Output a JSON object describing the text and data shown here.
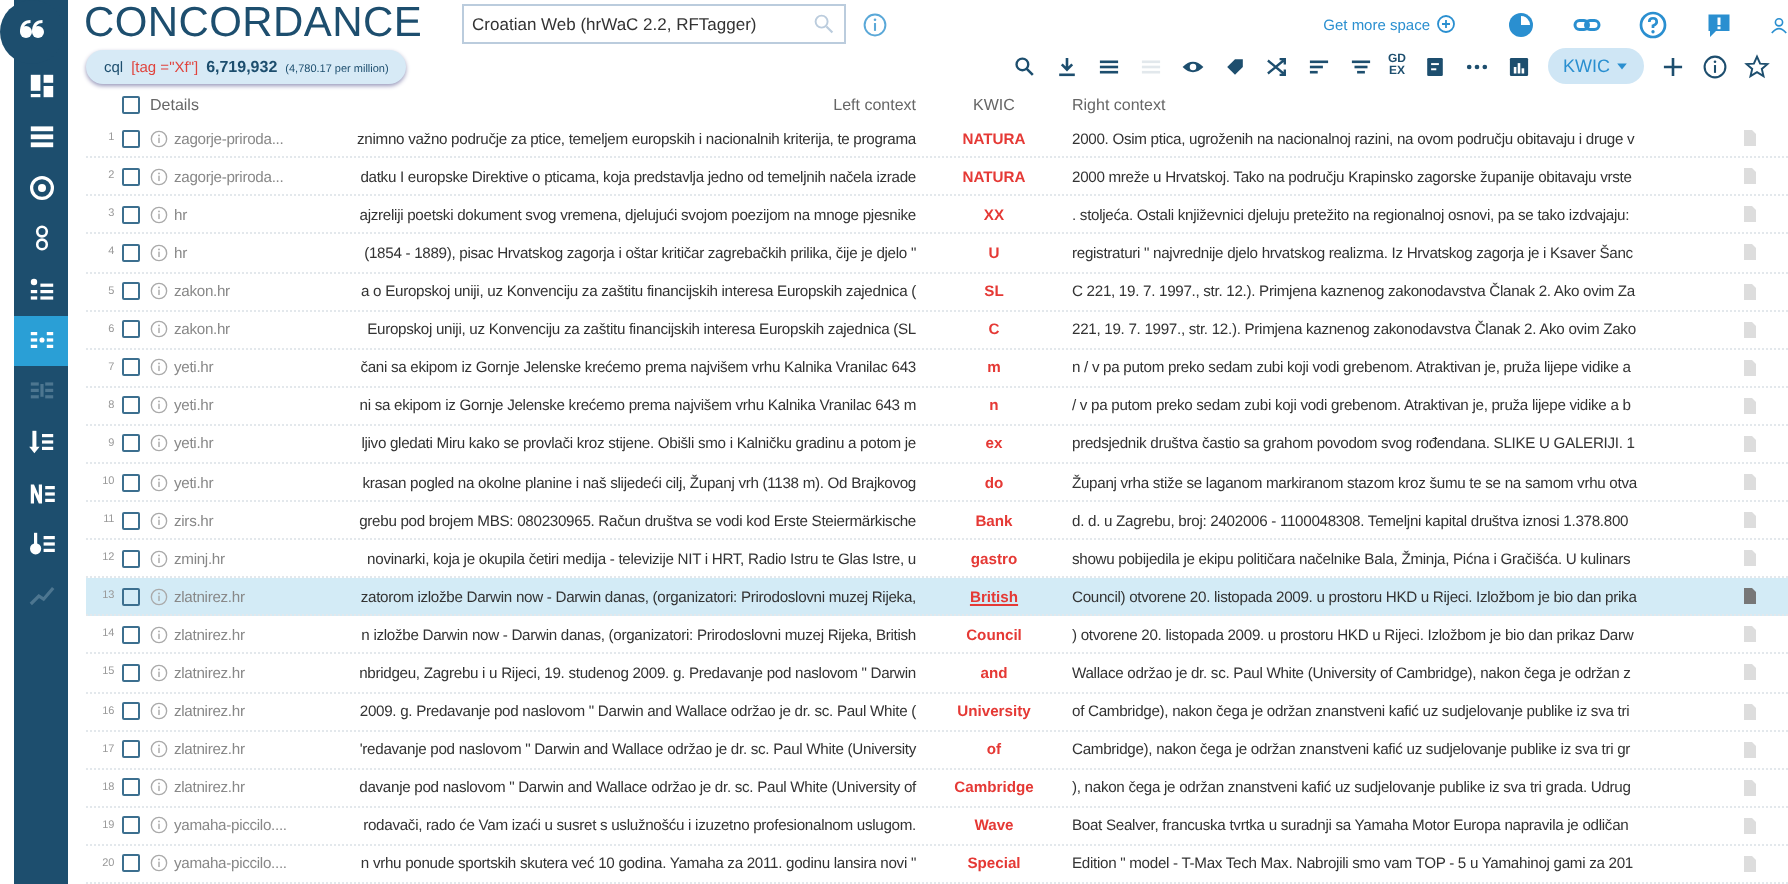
{
  "app": {
    "title": "CONCORDANCE"
  },
  "corpus_field": {
    "value": "Croatian Web (hrWaC 2.2, RFTagger)"
  },
  "get_more_space": "Get more space",
  "query": {
    "type": "cql",
    "expression": "[tag =\"Xf\"]",
    "count": "6,719,932",
    "per_million": "(4,780.17 per million)"
  },
  "sidebar": [
    {
      "kind": "dashboard",
      "selected": false,
      "disabled": false
    },
    {
      "kind": "list",
      "selected": false,
      "disabled": false
    },
    {
      "kind": "target",
      "selected": false,
      "disabled": false
    },
    {
      "kind": "chain",
      "selected": false,
      "disabled": false
    },
    {
      "kind": "bullets",
      "selected": false,
      "disabled": false
    },
    {
      "kind": "concordance",
      "selected": true,
      "disabled": false
    },
    {
      "kind": "parallel",
      "selected": false,
      "disabled": true
    },
    {
      "kind": "sort",
      "selected": false,
      "disabled": false
    },
    {
      "kind": "entities",
      "selected": false,
      "disabled": false
    },
    {
      "kind": "frequency",
      "selected": false,
      "disabled": false
    },
    {
      "kind": "trend",
      "selected": false,
      "disabled": true
    }
  ],
  "toolbar": {
    "items": [
      {
        "kind": "search",
        "disabled": false
      },
      {
        "kind": "download",
        "disabled": false
      },
      {
        "kind": "lines",
        "disabled": false
      },
      {
        "kind": "lines",
        "disabled": true
      },
      {
        "kind": "eye",
        "disabled": false
      },
      {
        "kind": "tag",
        "disabled": false
      },
      {
        "kind": "shuffle",
        "disabled": false
      },
      {
        "kind": "sort-left",
        "disabled": false
      },
      {
        "kind": "filter",
        "disabled": false
      },
      {
        "kind": "gdex",
        "label": "GD EX",
        "disabled": false
      },
      {
        "kind": "document",
        "disabled": false
      },
      {
        "kind": "dots",
        "disabled": false
      },
      {
        "kind": "chart",
        "disabled": false
      }
    ],
    "view_mode": "KWIC"
  },
  "table": {
    "all_checked": false,
    "columns": [
      "Details",
      "Left context",
      "KWIC",
      "Right context"
    ],
    "rows": [
      {
        "number": "1",
        "details": "zagorje-priroda...",
        "left": "znimno važno područje za ptice, temeljem europskih i nacionalnih kriterija, te programa",
        "kwic": "NATURA",
        "right": "2000. Osim ptica, ugroženih na nacionalnoj razini, na ovom području obitavaju i druge v",
        "checked": false,
        "selected": false
      },
      {
        "number": "2",
        "details": "zagorje-priroda...",
        "left": "datku I europske Direktive o pticama, koja predstavlja jedno od temeljnih načela izrade",
        "kwic": "NATURA",
        "right": "2000 mreže u Hrvatskoj. Tako na području Krapinsko zagorske županije obitavaju vrste",
        "checked": false,
        "selected": false
      },
      {
        "number": "3",
        "details": "hr",
        "left": "ajzreliji poetski dokument svog vremena, djelujući svojom poezijom na mnoge pjesnike",
        "kwic": "XX",
        "right": ". stoljeća. Ostali književnici djeluju pretežito na regionalnoj osnovi, pa se tako izdvajaju:",
        "checked": false,
        "selected": false
      },
      {
        "number": "4",
        "details": "hr",
        "left": "(1854 - 1889), pisac Hrvatskog zagorja i oštar kritičar zagrebačkih prilika, čije je djelo \"",
        "kwic": "U",
        "right": "registraturi \" najvrednije djelo hrvatskog realizma. Iz Hrvatskog zagorja je i Ksaver Šanc",
        "checked": false,
        "selected": false
      },
      {
        "number": "5",
        "details": "zakon.hr",
        "left": "a o Europskoj uniji, uz Konvenciju za zaštitu financijskih interesa Europskih zajednica (",
        "kwic": "SL",
        "right": "C 221, 19. 7. 1997., str. 12.). Primjena kaznenog zakonodavstva Članak 2. Ako ovim Za",
        "checked": false,
        "selected": false
      },
      {
        "number": "6",
        "details": "zakon.hr",
        "left": "Europskoj uniji, uz Konvenciju za zaštitu financijskih interesa Europskih zajednica (SL",
        "kwic": "C",
        "right": "221, 19. 7. 1997., str. 12.). Primjena kaznenog zakonodavstva Članak 2. Ako ovim Zako",
        "checked": false,
        "selected": false
      },
      {
        "number": "7",
        "details": "yeti.hr",
        "left": "čani sa ekipom iz Gornje Jelenske krećemo prema najvišem vrhu Kalnika Vranilac 643",
        "kwic": "m",
        "right": "n / v pa putom preko sedam zubi koji vodi grebenom. Atraktivan je, pruža lijepe vidike a",
        "checked": false,
        "selected": false
      },
      {
        "number": "8",
        "details": "yeti.hr",
        "left": "ni sa ekipom iz Gornje Jelenske krećemo prema najvišem vrhu Kalnika Vranilac 643 m",
        "kwic": "n",
        "right": "/ v pa putom preko sedam zubi koji vodi grebenom. Atraktivan je, pruža lijepe vidike a b",
        "checked": false,
        "selected": false
      },
      {
        "number": "9",
        "details": "yeti.hr",
        "left": "ljivo gledati Miru kako se provlači kroz stijene. Obišli smo i Kalničku gradinu a potom je",
        "kwic": "ex",
        "right": "predsjednik društva častio sa grahom povodom svog rođendana. SLIKE U GALERIJI. 1",
        "checked": false,
        "selected": false
      },
      {
        "number": "10",
        "details": "yeti.hr",
        "left": "krasan pogled na okolne planine i naš slijedeći cilj, Županj vrh (1138 m). Od Brajkovog",
        "kwic": "do",
        "right": "Županj vrha stiže se laganom markiranom stazom kroz šumu te se na samom vrhu otva",
        "checked": false,
        "selected": false
      },
      {
        "number": "11",
        "details": "zirs.hr",
        "left": "grebu pod brojem MBS: 080230965. Račun društva se vodi kod Erste Steiermärkische",
        "kwic": "Bank",
        "right": "d. d. u Zagrebu, broj: 2402006 - 1100048308. Temeljni kapital društva iznosi 1.378.800",
        "checked": false,
        "selected": false
      },
      {
        "number": "12",
        "details": "zminj.hr",
        "left": "novinarki, koja je okupila četiri medija - televizije NIT i HRT, Radio Istru te Glas Istre, u",
        "kwic": "gastro",
        "right": "showu pobijedila je ekipu političara načelnike Bala, Žminja, Pićna i Gračišća. U kulinars",
        "checked": false,
        "selected": false
      },
      {
        "number": "13",
        "details": "zlatnirez.hr",
        "left": "zatorom izložbe Darwin now - Darwin danas, (organizatori: Prirodoslovni muzej Rijeka,",
        "kwic": "British",
        "right": "Council) otvorene 20. listopada 2009. u prostoru HKD u Rijeci. Izložbom je bio dan prika",
        "checked": false,
        "selected": true
      },
      {
        "number": "14",
        "details": "zlatnirez.hr",
        "left": "n izložbe Darwin now - Darwin danas, (organizatori: Prirodoslovni muzej Rijeka, British",
        "kwic": "Council",
        "right": ") otvorene 20. listopada 2009. u prostoru HKD u Rijeci. Izložbom je bio dan prikaz Darw",
        "checked": false,
        "selected": false
      },
      {
        "number": "15",
        "details": "zlatnirez.hr",
        "left": "nbridgeu, Zagrebu i u Rijeci, 19. studenog 2009. g. Predavanje pod naslovom \" Darwin",
        "kwic": "and",
        "right": "Wallace održao je dr. sc. Paul White (University of Cambridge), nakon čega je održan z",
        "checked": false,
        "selected": false
      },
      {
        "number": "16",
        "details": "zlatnirez.hr",
        "left": "2009. g. Predavanje pod naslovom \" Darwin and Wallace održao je dr. sc. Paul White (",
        "kwic": "University",
        "right": "of Cambridge), nakon čega je održan znanstveni kafić uz sudjelovanje publike iz sva tri",
        "checked": false,
        "selected": false
      },
      {
        "number": "17",
        "details": "zlatnirez.hr",
        "left": "'redavanje pod naslovom \" Darwin and Wallace održao je dr. sc. Paul White (University",
        "kwic": "of",
        "right": "Cambridge), nakon čega je održan znanstveni kafić uz sudjelovanje publike iz sva tri gr",
        "checked": false,
        "selected": false
      },
      {
        "number": "18",
        "details": "zlatnirez.hr",
        "left": "davanje pod naslovom \" Darwin and Wallace održao je dr. sc. Paul White (University of",
        "kwic": "Cambridge",
        "right": "), nakon čega je održan znanstveni kafić uz sudjelovanje publike iz sva tri grada. Udrug",
        "checked": false,
        "selected": false
      },
      {
        "number": "19",
        "details": "yamaha-piccilo....",
        "left": "rodavači, rado će Vam izaći u susret s uslužnošću i izuzetno profesionalnom uslugom.",
        "kwic": "Wave",
        "right": "Boat Sealver, francuska tvrtka u suradnji sa Yamaha Motor Europa napravila je odličan",
        "checked": false,
        "selected": false
      },
      {
        "number": "20",
        "details": "yamaha-piccilo....",
        "left": "n vrhu ponude sportskih skutera već 10 godina. Yamaha za 2011. godinu lansira novi \"",
        "kwic": "Special",
        "right": "Edition \" model - T-Max Tech Max. Nabrojili smo vam TOP - 5 u Yamahinoj gami za 201",
        "checked": false,
        "selected": false
      }
    ]
  }
}
